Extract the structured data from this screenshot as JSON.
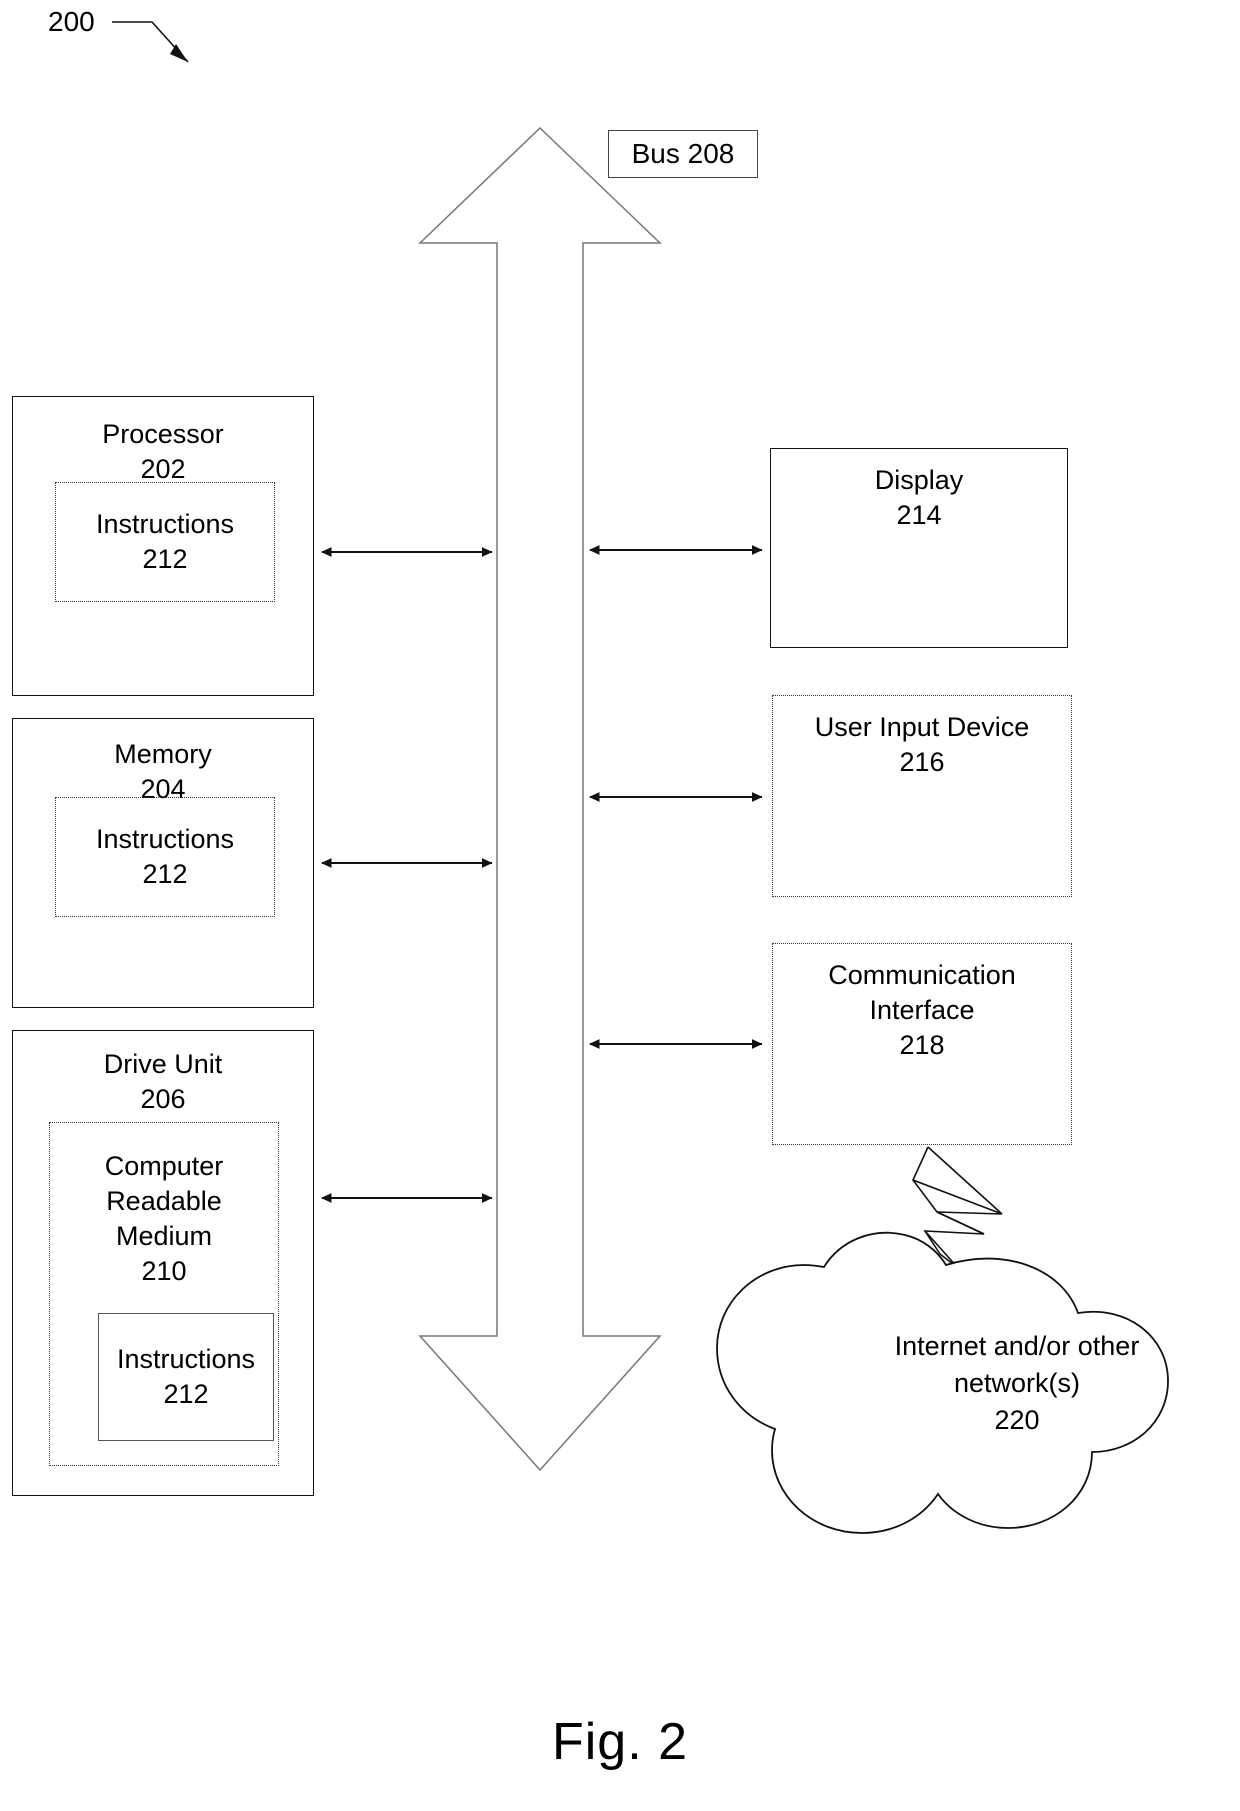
{
  "figure": {
    "number_ref": "200",
    "caption": "Fig. 2"
  },
  "bus": {
    "label": "Bus 208"
  },
  "left_column": [
    {
      "name": "processor",
      "label": "Processor",
      "ref": "202",
      "nested": [
        {
          "name": "instructions",
          "label": "Instructions",
          "ref": "212",
          "border": "dotted"
        }
      ]
    },
    {
      "name": "memory",
      "label": "Memory",
      "ref": "204",
      "nested": [
        {
          "name": "instructions",
          "label": "Instructions",
          "ref": "212",
          "border": "dotted"
        }
      ]
    },
    {
      "name": "drive-unit",
      "label": "Drive Unit",
      "ref": "206",
      "nested": [
        {
          "name": "computer-readable-medium",
          "label": "Computer\nReadable\nMedium",
          "ref": "210",
          "border": "dotted",
          "nested": [
            {
              "name": "instructions",
              "label": "Instructions",
              "ref": "212",
              "border": "solid"
            }
          ]
        }
      ]
    }
  ],
  "right_column": [
    {
      "name": "display",
      "label": "Display",
      "ref": "214"
    },
    {
      "name": "user-input-device",
      "label": "User Input Device",
      "ref": "216"
    },
    {
      "name": "communication-interface",
      "label": "Communication\nInterface",
      "ref": "218"
    }
  ],
  "network": {
    "label": "Internet and/or other\nnetwork(s)",
    "ref": "220"
  },
  "colors": {
    "stroke": "#111111",
    "dotted_stroke": "#333333",
    "background": "#ffffff"
  }
}
